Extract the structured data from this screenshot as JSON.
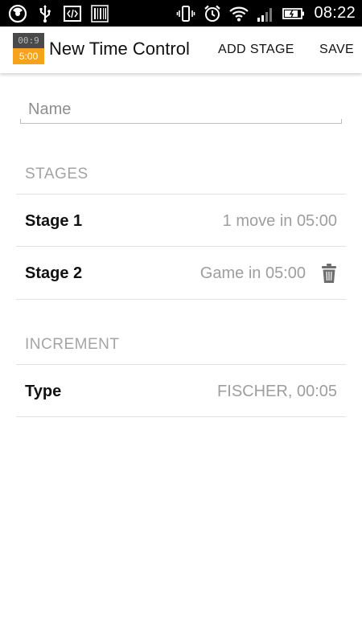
{
  "status_bar": {
    "left_icons": [
      "chrome-icon",
      "usb-icon",
      "code-icon",
      "barcode-icon"
    ],
    "right_icons": [
      "vibrate-icon",
      "alarm-icon",
      "wifi-icon",
      "signal-icon",
      "battery-icon"
    ],
    "time": "08:22"
  },
  "action_bar": {
    "app_icon": {
      "top_text": "00:9",
      "bottom_text": "5:00"
    },
    "title": "New Time Control",
    "add_stage_label": "ADD STAGE",
    "save_label": "SAVE"
  },
  "form": {
    "name": {
      "value": "",
      "placeholder": "Name"
    }
  },
  "stages": {
    "header": "STAGES",
    "items": [
      {
        "label": "Stage 1",
        "value": "1 move in 05:00",
        "deletable": false
      },
      {
        "label": "Stage 2",
        "value": "Game in 05:00",
        "deletable": true
      }
    ]
  },
  "increment": {
    "header": "INCREMENT",
    "type_label": "Type",
    "type_value": "FISCHER, 00:05"
  },
  "colors": {
    "accent": "#f7a21d",
    "status_bar": "#000000",
    "secondary_text": "#9e9e9e"
  }
}
